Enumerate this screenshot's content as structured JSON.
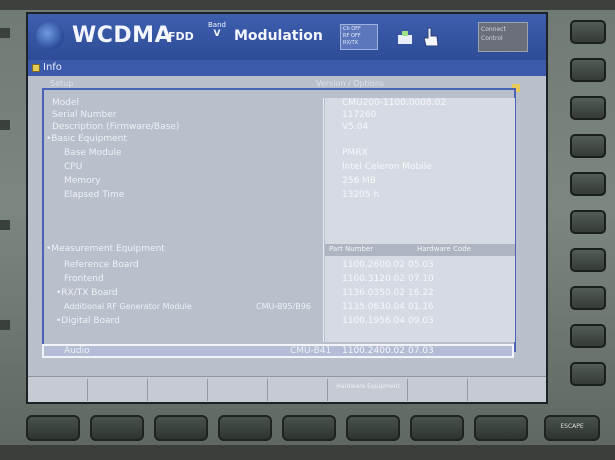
{
  "header": {
    "title": "WCDMA",
    "fdd": "FDD",
    "band_label": "Band",
    "band_value": "V",
    "modulation": "Modulation",
    "status_lines": [
      "Ch OFF",
      "RF OFF",
      "RX/TX"
    ],
    "panel_lines": [
      "Connect",
      "Control"
    ]
  },
  "infobar": {
    "title": "Info"
  },
  "columns": {
    "name": "Setup",
    "value": "Version / Options"
  },
  "rows": [
    {
      "name": "Model",
      "value": "CMU200-1100.0008.02"
    },
    {
      "name": "Serial Number",
      "value": "117260"
    },
    {
      "name": "Description (Firmware/Base)",
      "value": "V5.04"
    },
    {
      "name": "•Basic Equipment",
      "value": ""
    },
    {
      "name": "Base Module",
      "value": "PMRX"
    },
    {
      "name": "CPU",
      "value": "Intel Celeron Mobile"
    },
    {
      "name": "Memory",
      "value": "256 MB"
    },
    {
      "name": "Elapsed Time",
      "value": "13205 h"
    },
    {
      "name": "•Measurement Equipment",
      "value": "Part Number",
      "value2": "Hardware Code"
    },
    {
      "name": "Reference Board",
      "value": "1100.2600.02",
      "value2": "05.03"
    },
    {
      "name": "Frontend",
      "value": "1100.3120.02",
      "value2": "07.10"
    },
    {
      "name": "•RX/TX Board",
      "value": "1136.0350.02",
      "value2": "16.22"
    },
    {
      "name": "Additional RF Generator Module",
      "type": "CMU-B95/B96",
      "value": "1135.0630.04",
      "value2": "01.16"
    },
    {
      "name": "•Digital Board",
      "value": "1100.1956.04",
      "value2": "09.03"
    },
    {
      "name": "Audio",
      "type": "CMU-B41",
      "value": "1100.2400.02",
      "value2": "07.03"
    }
  ],
  "softkeys": [
    "",
    "",
    "",
    "",
    "",
    "Hardware Equipment",
    "",
    ""
  ],
  "side_keys": [
    "",
    "",
    "",
    "",
    "",
    "",
    "",
    "",
    "",
    "",
    ""
  ],
  "bottom_keys": [
    "",
    "",
    "",
    "",
    "",
    "",
    "",
    "",
    "ESCAPE"
  ],
  "colors": {
    "header_blue": "#3d5fae",
    "frame_blue": "#4a63b6",
    "screen_gray": "#b9bfcb"
  }
}
